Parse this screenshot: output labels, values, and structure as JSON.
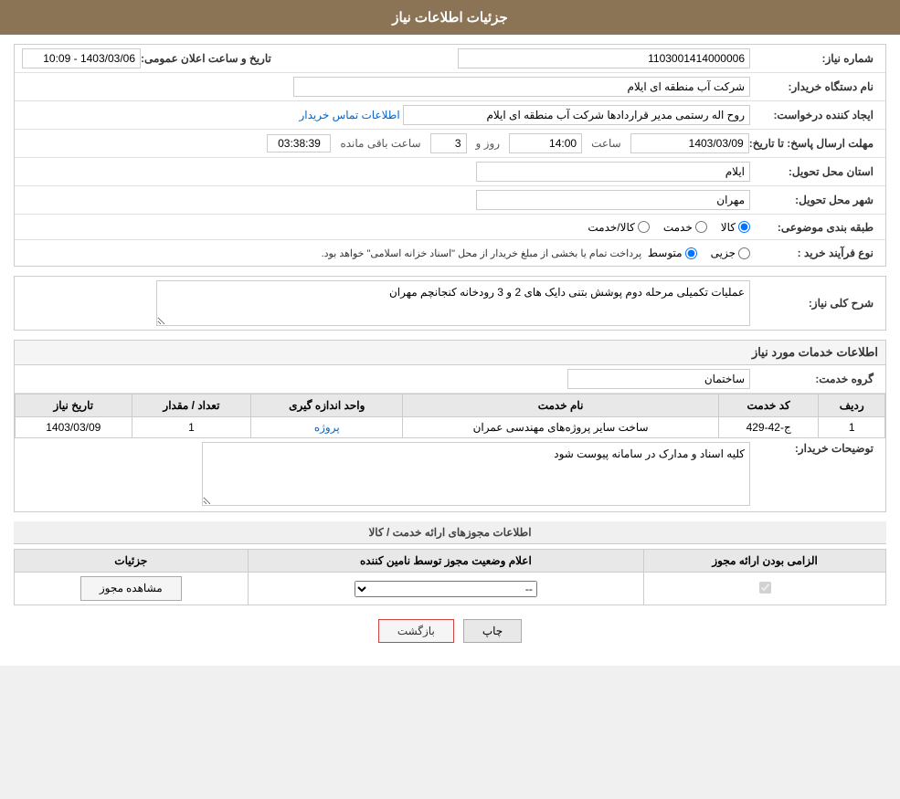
{
  "header": {
    "title": "جزئیات اطلاعات نیاز"
  },
  "form": {
    "need_number_label": "شماره نیاز:",
    "need_number_value": "1103001414000006",
    "buyer_org_label": "نام دستگاه خریدار:",
    "buyer_org_value": "شرکت آب منطقه ای ایلام",
    "creator_label": "ایجاد کننده درخواست:",
    "creator_value": "روح اله رستمی مدیر قراردادها شرکت آب منطقه ای ایلام",
    "creator_link": "اطلاعات تماس خریدار",
    "deadline_label": "مهلت ارسال پاسخ: تا تاریخ:",
    "deadline_date": "1403/03/09",
    "deadline_time_label": "ساعت",
    "deadline_time": "14:00",
    "deadline_days_label": "روز و",
    "deadline_days": "3",
    "deadline_remaining_label": "ساعت باقی مانده",
    "deadline_remaining": "03:38:39",
    "announce_label": "تاریخ و ساعت اعلان عمومی:",
    "announce_value": "1403/03/06 - 10:09",
    "province_label": "استان محل تحویل:",
    "province_value": "ایلام",
    "city_label": "شهر محل تحویل:",
    "city_value": "مهران",
    "category_label": "طبقه بندی موضوعی:",
    "category_options": [
      "کالا",
      "خدمت",
      "کالا/خدمت"
    ],
    "category_selected": "کالا",
    "purchase_type_label": "نوع فرآیند خرید :",
    "purchase_type_options": [
      "جزیی",
      "متوسط"
    ],
    "purchase_type_selected": "متوسط",
    "purchase_type_note": "پرداخت تمام یا بخشی از مبلغ خریدار از محل \"اسناد خزانه اسلامی\" خواهد بود.",
    "need_desc_label": "شرح کلی نیاز:",
    "need_desc_value": "عملیات تکمیلی مرحله دوم پوشش بتنی دایک های 2 و 3 رودخانه کنجانچم مهران",
    "services_header": "اطلاعات خدمات مورد نیاز",
    "service_group_label": "گروه خدمت:",
    "service_group_value": "ساختمان",
    "table": {
      "columns": [
        "ردیف",
        "کد خدمت",
        "نام خدمت",
        "واحد اندازه گیری",
        "تعداد / مقدار",
        "تاریخ نیاز"
      ],
      "rows": [
        {
          "row": "1",
          "code": "ج-42-429",
          "name": "ساخت سایر پروژه‌های مهندسی عمران",
          "unit": "پروژه",
          "quantity": "1",
          "date": "1403/03/09"
        }
      ]
    },
    "buyer_notes_label": "توضیحات خریدار:",
    "buyer_notes_value": "کلیه اسناد و مدارک در سامانه پیوست شود",
    "licenses_header": "اطلاعات مجوزهای ارائه خدمت / کالا",
    "licenses_table": {
      "columns": [
        "الزامی بودن ارائه مجوز",
        "اعلام وضعیت مجوز توسط نامین کننده",
        "جزئیات"
      ],
      "rows": [
        {
          "required": true,
          "status": "--",
          "details_btn": "مشاهده مجوز"
        }
      ]
    },
    "btn_print": "چاپ",
    "btn_back": "بازگشت"
  }
}
